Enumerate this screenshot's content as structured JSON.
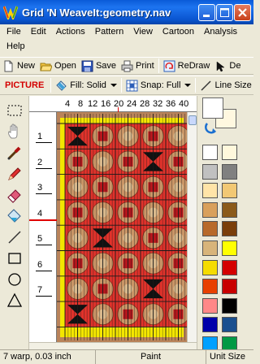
{
  "window": {
    "title": "Grid 'N WeaveIt:geometry.nav"
  },
  "menus": [
    "File",
    "Edit",
    "Actions",
    "Pattern",
    "View",
    "Cartoon",
    "Analysis",
    "Help"
  ],
  "toolbar": {
    "new_label": "New",
    "open_label": "Open",
    "save_label": "Save",
    "print_label": "Print",
    "redraw_label": "ReDraw",
    "de_label": "De"
  },
  "toolbar2": {
    "mode_label": "PICTURE",
    "fill_label": "Fill: Solid",
    "snap_label": "Snap: Full",
    "line_size_label": "Line Size"
  },
  "tools": [
    "select-tool",
    "hand-tool",
    "eyedropper-tool",
    "pencil-tool",
    "eraser-tool",
    "paint-bucket-tool",
    "line-tool",
    "rectangle-tool",
    "ellipse-tool",
    "triangle-tool"
  ],
  "ruler": {
    "top": [
      "4",
      "8",
      "12",
      "16",
      "20",
      "24",
      "28",
      "32",
      "36",
      "40"
    ],
    "left": [
      "1",
      "2",
      "3",
      "4",
      "5",
      "6",
      "7"
    ],
    "current_column": 20,
    "current_row": 4
  },
  "colors": {
    "foreground": "#ffffff",
    "background": "#fff8e0",
    "palette": [
      "#ffffff",
      "#fff8dc",
      "#c0c0c0",
      "#808080",
      "#ffe4a8",
      "#f2c874",
      "#d9a05c",
      "#8b5a1a",
      "#b86a2a",
      "#7a3e0a",
      "#d8b47a",
      "#ffff00",
      "#f5dc00",
      "#d40000",
      "#e84000",
      "#c80000",
      "#ff8888",
      "#000000",
      "#0000aa",
      "#1a4f8f",
      "#00a0ff",
      "#009944"
    ]
  },
  "weave_colors": {
    "border": "#b9835a",
    "frame": "#f3e600",
    "red": "#e0322b",
    "dark_red": "#b5161c",
    "circle": "#c99566",
    "circle_ring": "#8a2b1c",
    "center": "#d8b88c",
    "grid_line": "#1a1a1a"
  },
  "status": {
    "warp": "7 warp,  0.03 inch",
    "mode": "Paint",
    "unit": "Unit Size"
  }
}
